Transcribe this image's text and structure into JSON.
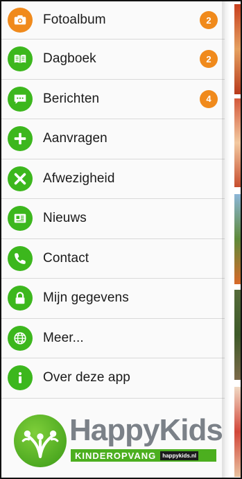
{
  "menu": {
    "items": [
      {
        "label": "Fotoalbum",
        "icon": "camera-icon",
        "badge": "2"
      },
      {
        "label": "Dagboek",
        "icon": "book-icon",
        "badge": "2"
      },
      {
        "label": "Berichten",
        "icon": "message-icon",
        "badge": "4"
      },
      {
        "label": "Aanvragen",
        "icon": "plus-icon"
      },
      {
        "label": "Afwezigheid",
        "icon": "close-x-icon"
      },
      {
        "label": "Nieuws",
        "icon": "newspaper-icon"
      },
      {
        "label": "Contact",
        "icon": "phone-icon"
      },
      {
        "label": "Mijn gegevens",
        "icon": "lock-icon"
      },
      {
        "label": "Meer...",
        "icon": "globe-icon"
      },
      {
        "label": "Over deze app",
        "icon": "info-icon"
      }
    ]
  },
  "logo": {
    "title": "HappyKids",
    "subtitle": "KINDEROPVANG",
    "url": "happykids.nl"
  },
  "colors": {
    "green": "#3cb71d",
    "orange": "#f08a1c",
    "logo_gray": "#7b8188"
  }
}
